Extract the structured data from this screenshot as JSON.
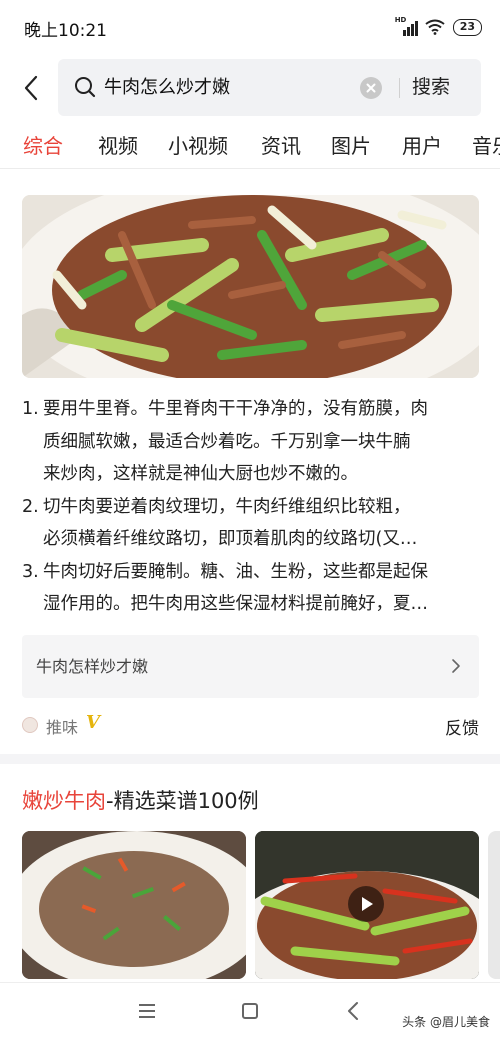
{
  "status": {
    "time": "晚上10:21",
    "battery": "23",
    "signal_label": "HD"
  },
  "search": {
    "query": "牛肉怎么炒才嫩",
    "button_label": "搜索"
  },
  "tabs": [
    {
      "label": "综合",
      "active": true
    },
    {
      "label": "视频",
      "active": false
    },
    {
      "label": "小视频",
      "active": false
    },
    {
      "label": "资讯",
      "active": false
    },
    {
      "label": "图片",
      "active": false
    },
    {
      "label": "用户",
      "active": false
    },
    {
      "label": "音乐",
      "active": false
    }
  ],
  "result": {
    "items": [
      {
        "num": "1.",
        "lines": [
          "要用牛里脊。牛里脊肉干干净净的，没有筋膜，肉",
          "质细腻软嫩，最适合炒着吃。千万别拿一块牛腩",
          "来炒肉，这样就是神仙大厨也炒不嫩的。"
        ]
      },
      {
        "num": "2.",
        "lines": [
          "切牛肉要逆着肉纹理切，牛肉纤维组织比较粗，",
          "必须横着纤维纹路切，即顶着肌肉的纹路切(又…"
        ]
      },
      {
        "num": "3.",
        "lines": [
          "牛肉切好后要腌制。糖、油、生粉，这些都是起保",
          "湿作用的。把牛肉用这些保湿材料提前腌好，夏…"
        ]
      }
    ],
    "related_query": "牛肉怎样炒才嫩",
    "source_name": "推味",
    "verified_mark": "V",
    "feedback_label": "反馈"
  },
  "recipes": {
    "title_highlight": "嫩炒牛肉",
    "title_rest": "-精选菜谱100例"
  },
  "watermark": "头条 @眉儿美食",
  "colors": {
    "accent": "#e8443a",
    "verified": "#e5b40c"
  }
}
